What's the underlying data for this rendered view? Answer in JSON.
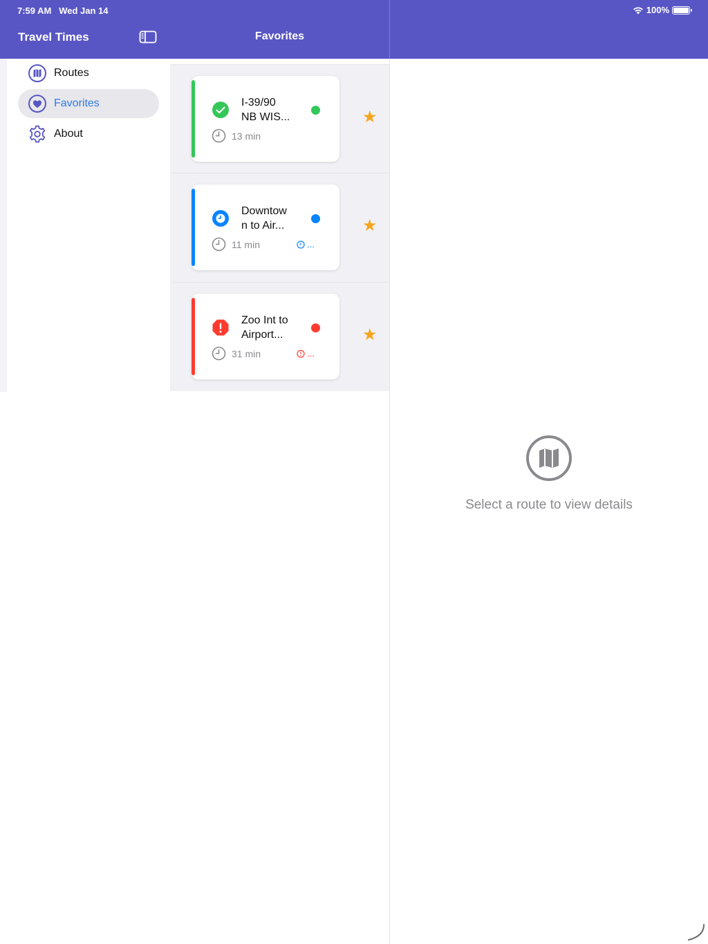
{
  "status_bar": {
    "time": "7:59 AM",
    "date": "Wed Jan 14",
    "battery": "100%",
    "wifi_icon": "wifi-icon",
    "battery_icon": "battery-icon"
  },
  "sidebar": {
    "title": "Travel Times",
    "toggle_icon": "sidebar-toggle-icon",
    "items": [
      {
        "label": "Routes",
        "icon": "map-icon",
        "selected": false
      },
      {
        "label": "Favorites",
        "icon": "heart-icon",
        "selected": true
      },
      {
        "label": "About",
        "icon": "gear-icon",
        "selected": false
      }
    ]
  },
  "list": {
    "title": "Favorites",
    "routes": [
      {
        "name": "I-39/90 NB WIS...",
        "line1": "I-39/90",
        "line2": "NB WIS...",
        "time": "13 min",
        "status": "ok",
        "color": "#34c759",
        "alert": "",
        "favorite_icon": "star-icon"
      },
      {
        "name": "Downtown to Air...",
        "line1": "Downtow",
        "line2": "n to Air...",
        "time": "11 min",
        "status": "info",
        "color": "#0a84ff",
        "alert": "...",
        "favorite_icon": "star-icon"
      },
      {
        "name": "Zoo Int to Airport...",
        "line1": "Zoo Int to",
        "line2": "Airport...",
        "time": "31 min",
        "status": "alert",
        "color": "#ff3b30",
        "alert": "...",
        "favorite_icon": "star-icon"
      }
    ]
  },
  "detail": {
    "empty_icon": "map-icon",
    "empty_text": "Select a route to view details"
  },
  "colors": {
    "header": "#5856c4",
    "accent": "#2f7ae5",
    "star": "#f7a51c",
    "secondary_text": "#8a8a8e"
  }
}
